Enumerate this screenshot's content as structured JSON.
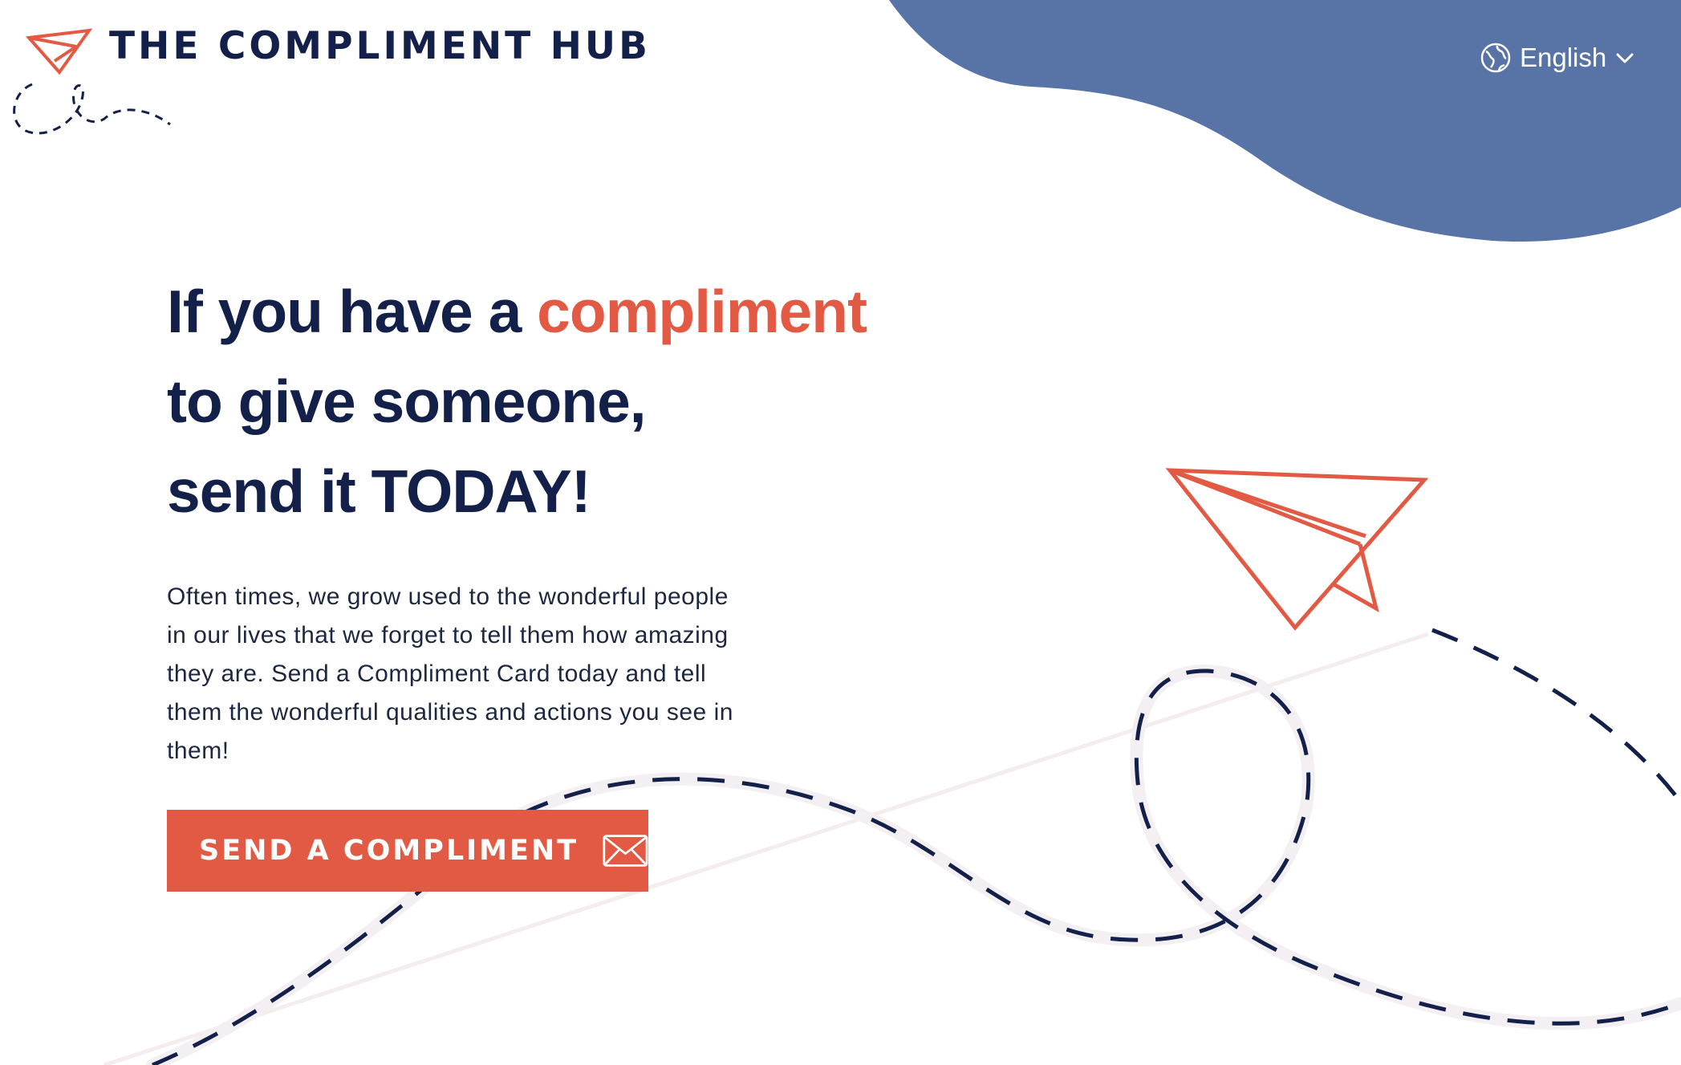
{
  "brand": {
    "name": "THE COMPLIMENT HUB",
    "logo_icon": "paper-plane-icon"
  },
  "language": {
    "selected": "English",
    "icon": "globe-icon",
    "dropdown_icon": "chevron-down-icon"
  },
  "hero": {
    "headline_part1": "If you have a ",
    "headline_accent": "compliment",
    "headline_part2": "to give someone,",
    "headline_part3": "send it TODAY!",
    "body": "Often times, we grow used to the wonderful people in our lives that we forget to tell them how amazing they are. Send a Compliment Card today and tell them the wonderful qualities and actions you see in them!",
    "cta_label": "SEND A COMPLIMENT",
    "cta_icon": "envelope-icon"
  },
  "colors": {
    "navy": "#13214a",
    "accent": "#e25a44",
    "blob": "#5874a6",
    "white": "#ffffff"
  }
}
